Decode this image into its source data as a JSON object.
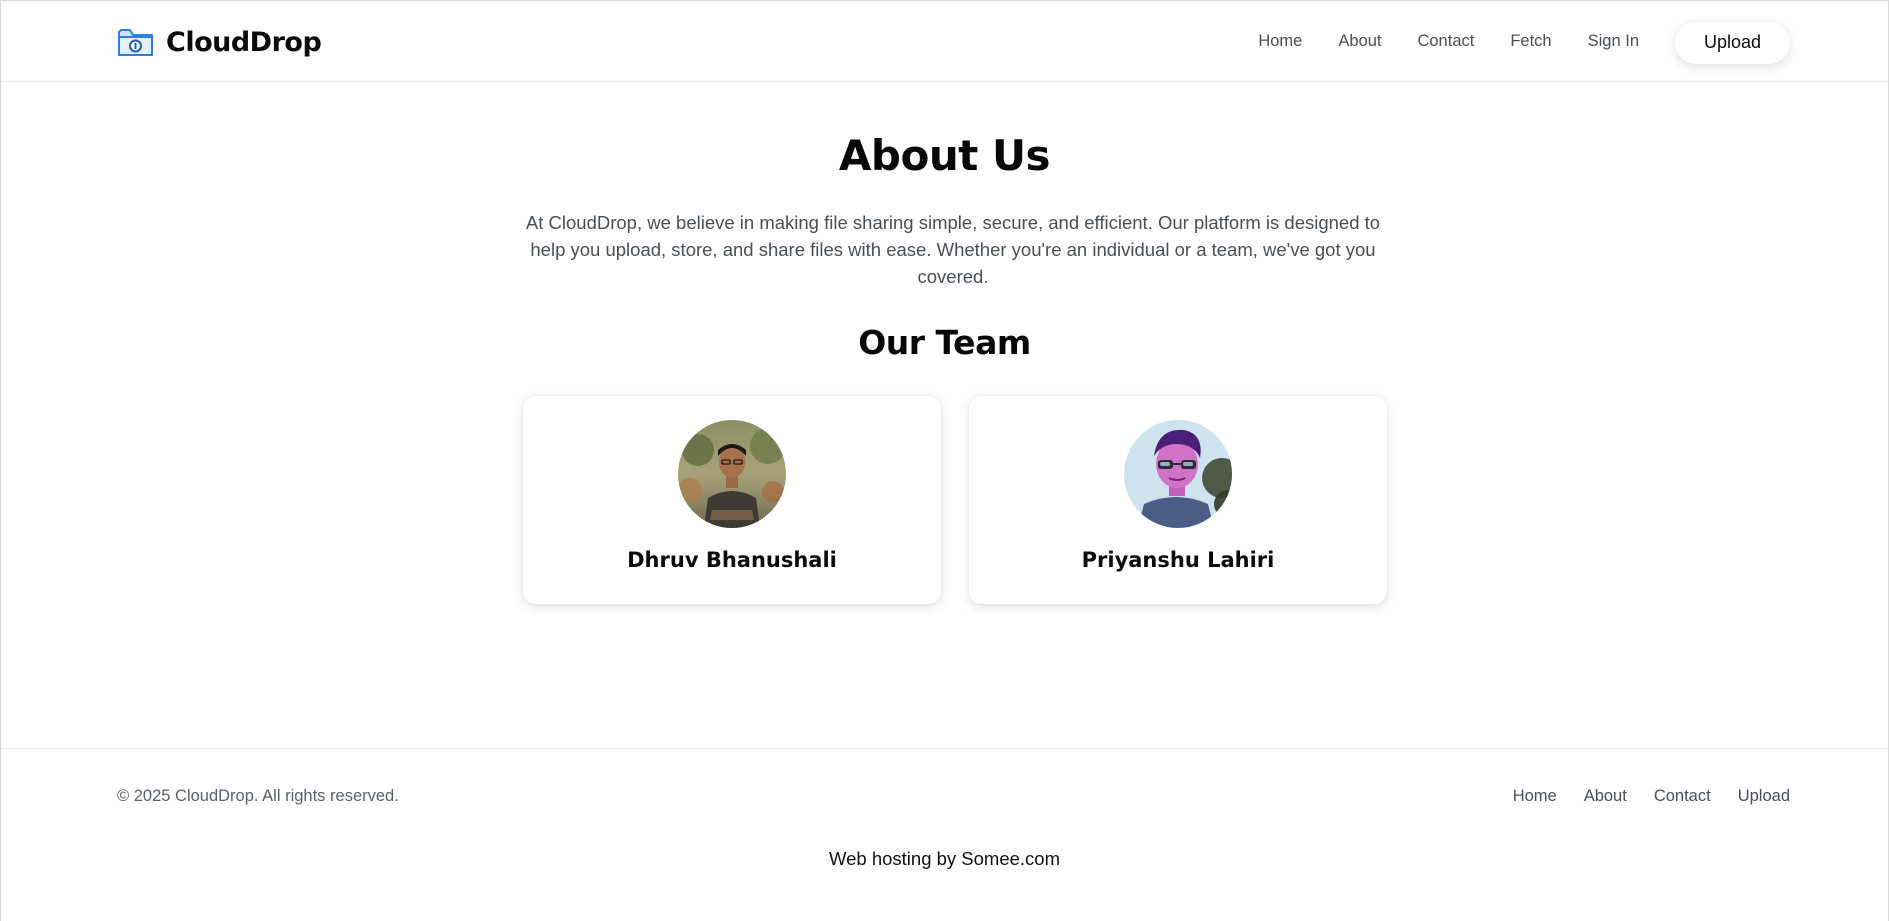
{
  "header": {
    "brand": "CloudDrop",
    "brand_icon": "folder-icon",
    "nav": [
      {
        "label": "Home"
      },
      {
        "label": "About"
      },
      {
        "label": "Contact"
      },
      {
        "label": "Fetch"
      },
      {
        "label": "Sign In"
      }
    ],
    "upload_label": "Upload"
  },
  "main": {
    "title": "About Us",
    "intro": "At CloudDrop, we believe in making file sharing simple, secure, and efficient. Our platform is designed to help you upload, store, and share files with ease. Whether you're an individual or a team, we've got you covered.",
    "team_title": "Our Team",
    "team": [
      {
        "name": "Dhruv Bhanushali",
        "avatar": "avatar-photo"
      },
      {
        "name": "Priyanshu Lahiri",
        "avatar": "avatar-photo"
      }
    ]
  },
  "footer": {
    "copyright": "© 2025 CloudDrop. All rights reserved.",
    "links": [
      {
        "label": "Home"
      },
      {
        "label": "About"
      },
      {
        "label": "Contact"
      },
      {
        "label": "Upload"
      }
    ],
    "hosting": "Web hosting by Somee.com"
  },
  "colors": {
    "accent": "#2f7de1",
    "text_muted": "#4a4f57",
    "text_dark": "#0b0b0b"
  }
}
